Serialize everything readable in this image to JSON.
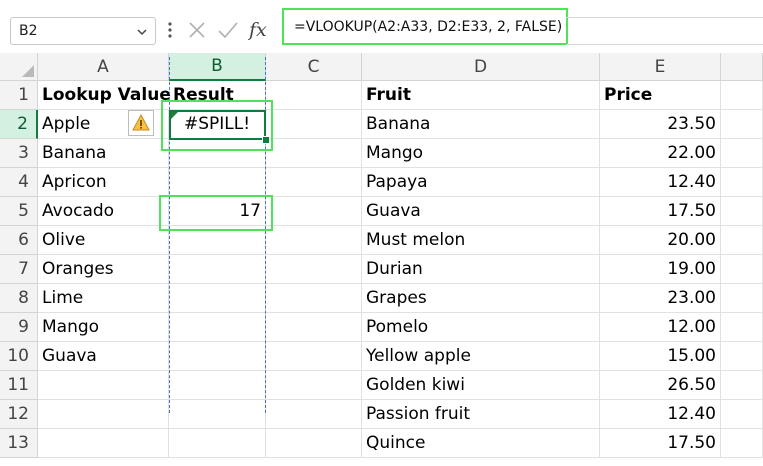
{
  "formula_bar": {
    "name_box": "B2",
    "formula": "=VLOOKUP(A2:A33, D2:E33, 2, FALSE)"
  },
  "columns": [
    "A",
    "B",
    "C",
    "D",
    "E"
  ],
  "rows": [
    "1",
    "2",
    "3",
    "4",
    "5",
    "6",
    "7",
    "8",
    "9",
    "10",
    "11",
    "12",
    "13"
  ],
  "cells": {
    "A1": "Lookup Value",
    "B1": "Result",
    "D1": "Fruit",
    "E1": "Price",
    "A2": "Apple",
    "B2": "#SPILL!",
    "D2": "Banana",
    "E2": "23.50",
    "A3": "Banana",
    "D3": "Mango",
    "E3": "22.00",
    "A4": "Apricon",
    "D4": "Papaya",
    "E4": "12.40",
    "A5": "Avocado",
    "B5": "17",
    "D5": "Guava",
    "E5": "17.50",
    "A6": "Olive",
    "D6": "Must melon",
    "E6": "20.00",
    "A7": "Oranges",
    "D7": "Durian",
    "E7": "19.00",
    "A8": "Lime",
    "D8": "Grapes",
    "E8": "23.00",
    "A9": "Mango",
    "D9": "Pomelo",
    "E9": "12.00",
    "A10": "Guava",
    "D10": "Yellow apple",
    "E10": "15.00",
    "D11": "Golden kiwi",
    "E11": "26.50",
    "D12": "Passion fruit",
    "E12": "12.40",
    "D13": "Quince",
    "E13": "17.50"
  },
  "colors": {
    "selection": "#107c41",
    "highlight": "#4fe35a",
    "spill_border": "#4472c4",
    "header_bg": "#f3f3f3"
  }
}
